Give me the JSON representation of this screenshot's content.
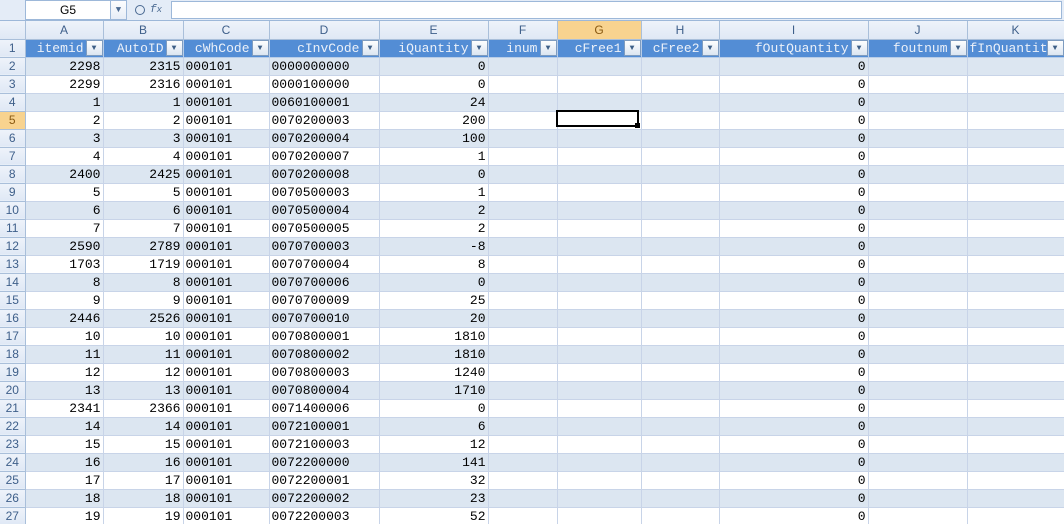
{
  "nameBox": "G5",
  "formulaBar": "",
  "activeCell": {
    "row": 5,
    "col": "G"
  },
  "columns": [
    "A",
    "B",
    "C",
    "D",
    "E",
    "F",
    "G",
    "H",
    "I",
    "J",
    "K"
  ],
  "headers": {
    "A": "itemid",
    "B": "AutoID",
    "C": "cWhCode",
    "D": "cInvCode",
    "E": "iQuantity",
    "F": "inum",
    "G": "cFree1",
    "H": "cFree2",
    "I": "fOutQuantity",
    "J": "foutnum",
    "K": "fInQuantity"
  },
  "rows": [
    {
      "n": 2,
      "A": "2298",
      "B": "2315",
      "C": "000101",
      "D": "0000000000",
      "E": "0",
      "I": "0"
    },
    {
      "n": 3,
      "A": "2299",
      "B": "2316",
      "C": "000101",
      "D": "0000100000",
      "E": "0",
      "I": "0"
    },
    {
      "n": 4,
      "A": "1",
      "B": "1",
      "C": "000101",
      "D": "0060100001",
      "E": "24",
      "I": "0"
    },
    {
      "n": 5,
      "A": "2",
      "B": "2",
      "C": "000101",
      "D": "0070200003",
      "E": "200",
      "I": "0"
    },
    {
      "n": 6,
      "A": "3",
      "B": "3",
      "C": "000101",
      "D": "0070200004",
      "E": "100",
      "I": "0"
    },
    {
      "n": 7,
      "A": "4",
      "B": "4",
      "C": "000101",
      "D": "0070200007",
      "E": "1",
      "I": "0"
    },
    {
      "n": 8,
      "A": "2400",
      "B": "2425",
      "C": "000101",
      "D": "0070200008",
      "E": "0",
      "I": "0"
    },
    {
      "n": 9,
      "A": "5",
      "B": "5",
      "C": "000101",
      "D": "0070500003",
      "E": "1",
      "I": "0"
    },
    {
      "n": 10,
      "A": "6",
      "B": "6",
      "C": "000101",
      "D": "0070500004",
      "E": "2",
      "I": "0"
    },
    {
      "n": 11,
      "A": "7",
      "B": "7",
      "C": "000101",
      "D": "0070500005",
      "E": "2",
      "I": "0"
    },
    {
      "n": 12,
      "A": "2590",
      "B": "2789",
      "C": "000101",
      "D": "0070700003",
      "E": "-8",
      "I": "0"
    },
    {
      "n": 13,
      "A": "1703",
      "B": "1719",
      "C": "000101",
      "D": "0070700004",
      "E": "8",
      "I": "0"
    },
    {
      "n": 14,
      "A": "8",
      "B": "8",
      "C": "000101",
      "D": "0070700006",
      "E": "0",
      "I": "0"
    },
    {
      "n": 15,
      "A": "9",
      "B": "9",
      "C": "000101",
      "D": "0070700009",
      "E": "25",
      "I": "0"
    },
    {
      "n": 16,
      "A": "2446",
      "B": "2526",
      "C": "000101",
      "D": "0070700010",
      "E": "20",
      "I": "0"
    },
    {
      "n": 17,
      "A": "10",
      "B": "10",
      "C": "000101",
      "D": "0070800001",
      "E": "1810",
      "I": "0"
    },
    {
      "n": 18,
      "A": "11",
      "B": "11",
      "C": "000101",
      "D": "0070800002",
      "E": "1810",
      "I": "0"
    },
    {
      "n": 19,
      "A": "12",
      "B": "12",
      "C": "000101",
      "D": "0070800003",
      "E": "1240",
      "I": "0"
    },
    {
      "n": 20,
      "A": "13",
      "B": "13",
      "C": "000101",
      "D": "0070800004",
      "E": "1710",
      "I": "0"
    },
    {
      "n": 21,
      "A": "2341",
      "B": "2366",
      "C": "000101",
      "D": "0071400006",
      "E": "0",
      "I": "0"
    },
    {
      "n": 22,
      "A": "14",
      "B": "14",
      "C": "000101",
      "D": "0072100001",
      "E": "6",
      "I": "0"
    },
    {
      "n": 23,
      "A": "15",
      "B": "15",
      "C": "000101",
      "D": "0072100003",
      "E": "12",
      "I": "0"
    },
    {
      "n": 24,
      "A": "16",
      "B": "16",
      "C": "000101",
      "D": "0072200000",
      "E": "141",
      "I": "0"
    },
    {
      "n": 25,
      "A": "17",
      "B": "17",
      "C": "000101",
      "D": "0072200001",
      "E": "32",
      "I": "0"
    },
    {
      "n": 26,
      "A": "18",
      "B": "18",
      "C": "000101",
      "D": "0072200002",
      "E": "23",
      "I": "0"
    },
    {
      "n": 27,
      "A": "19",
      "B": "19",
      "C": "000101",
      "D": "0072200003",
      "E": "52",
      "I": "0"
    }
  ],
  "textCols": [
    "C",
    "D"
  ],
  "colWidths": {
    "row": 25,
    "A": 78,
    "B": 80,
    "C": 86,
    "D": 110,
    "E": 109,
    "F": 69,
    "G": 84,
    "H": 78,
    "I": 149,
    "J": 99,
    "K": 97
  }
}
